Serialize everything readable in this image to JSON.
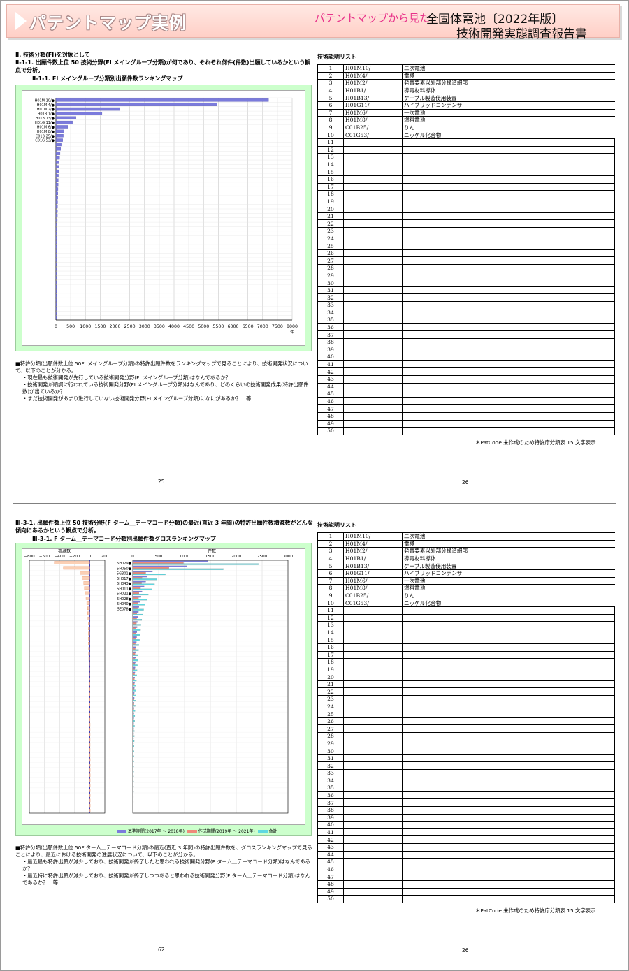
{
  "banner": {
    "title": "パテントマップ実例",
    "subtitle": "パテントマップから見た",
    "doc_title_1": "全固体電池〔2022年版〕",
    "doc_title_2": "技術開発実態調査報告書"
  },
  "page1": {
    "section": "Ⅱ. 技術分類(FI)を対象として",
    "heading": "Ⅱ-1-1. 出願件数上位 50 技術分野(FI メイングループ分類)が何であり、それぞれ何件(件数)出願しているかという観点で分析。",
    "chart_title": "Ⅱ-1-1. FI メイングループ分類別出願件数ランキングマップ",
    "bullets": [
      "■特許分類(出願件数上位 50FI メイングループ分類)の特許出願件数をランキングマップで見ることにより、技術開発状況について、以下のことが分かる。",
      "・現在最も技術開発が先行している技術開発分野(FI メイングループ分類)はなんであるか？",
      "・技術開発が順調に行われている技術開発分野(FI メイングループ分類)はなんであり、どのくらいの技術開発成果(特許出願件数)が出ているか？",
      "・まだ技術開発があまり進行していない技術開発分野(FI メイングループ分類)になにがあるか？　等"
    ],
    "page_left": "25",
    "page_right": "26"
  },
  "page2": {
    "heading": "Ⅲ-3-1. 出願件数上位 50 技術分野(F ターム＿テーマコード分類)の最近(直近 3 年間)の特許出願件数増減数がどんな傾向にあるかという観点で分析。",
    "chart_title": "Ⅲ-3-1. F ターム＿テーマコード分類別出願件数グロスランキングマップ",
    "bullets": [
      "■特許分類(出願件数上位 50F ターム＿テーマコード分類)の最近(直近 3 年間)の特許出願件数を、グロスランキングマップで見ることにより、最近における技術開発の進展状況について、以下のことが分かる。",
      "・最近最も特許出願が減少しており、技術開発が終了したと思われる技術開発分野(F ターム＿テーマコード分類)はなんであるか？",
      "・最近特に特許出願が減少しており、技術開発が終了しつつあると思われる技術開発分野(F ターム＿テーマコード分類)はなんであるか？　等"
    ],
    "page_left": "62",
    "page_right": "26"
  },
  "tech_list": {
    "title": "技術説明リスト",
    "rows": [
      {
        "no": "1",
        "code": "H01M10/",
        "desc": "二次電池"
      },
      {
        "no": "2",
        "code": "H01M4/",
        "desc": "電極"
      },
      {
        "no": "3",
        "code": "H01M2/",
        "desc": "発電要素以外部分構造細部"
      },
      {
        "no": "4",
        "code": "H01B1/",
        "desc": "導電材料導体"
      },
      {
        "no": "5",
        "code": "H01B13/",
        "desc": "ケーブル製造使用装置"
      },
      {
        "no": "6",
        "code": "H01G11/",
        "desc": "ハイブリッドコンデンサ"
      },
      {
        "no": "7",
        "code": "H01M6/",
        "desc": "一次電池"
      },
      {
        "no": "8",
        "code": "H01M8/",
        "desc": "燃料電池"
      },
      {
        "no": "9",
        "code": "C01B25/",
        "desc": "りん"
      },
      {
        "no": "10",
        "code": "C01G53/",
        "desc": "ニッケル化合物"
      }
    ],
    "empty_numbers": [
      "11",
      "12",
      "13",
      "14",
      "15",
      "16",
      "17",
      "18",
      "19",
      "20",
      "21",
      "22",
      "23",
      "24",
      "25",
      "26",
      "27",
      "28",
      "29",
      "30",
      "31",
      "32",
      "33",
      "34",
      "35",
      "36",
      "37",
      "38",
      "39",
      "40",
      "41",
      "42",
      "43",
      "44",
      "45",
      "46",
      "47",
      "48",
      "49",
      "50"
    ],
    "note": "＊PatCode 未作成のため特許庁分類表 15 文字表示"
  },
  "colors": {
    "banner_pink": "#ffcfc6",
    "subtitle_pink": "#e8338a",
    "chart_bg": "#ccffcc",
    "bar_blue": "#7b7bdc",
    "bar_red": "#ef8a7a",
    "bar_cyan": "#5fd8e0"
  },
  "chart_data": [
    {
      "type": "bar",
      "orientation": "horizontal",
      "title": "Ⅱ-1-1. FI メイングループ分類別出願件数ランキングマップ",
      "categories": [
        "H01M 10/●",
        "H01M 4/●",
        "H01M 2/●",
        "H01B 1/●",
        "H01B 13/●",
        "H01G 11/●",
        "H01M 6/●",
        "H01M 8/●",
        "C01B 25/●",
        "C01G 53/●"
      ],
      "values": [
        7200,
        5450,
        2170,
        1560,
        680,
        560,
        400,
        280,
        250,
        230,
        180,
        160,
        140,
        125,
        110,
        100,
        90,
        85,
        80,
        75,
        70,
        66,
        62,
        58,
        55,
        52,
        49,
        46,
        43,
        40,
        38,
        36,
        34,
        32,
        30,
        28,
        26,
        24,
        22,
        20,
        18,
        17,
        16,
        15,
        14,
        13,
        12,
        11,
        10,
        10
      ],
      "xlim": [
        0,
        8000
      ],
      "xticks": [
        "0",
        "500",
        "1000",
        "1500",
        "2000",
        "2500",
        "3000",
        "3500",
        "4000",
        "4500",
        "5000",
        "5500",
        "6000",
        "6500",
        "7000",
        "7500",
        "8000"
      ],
      "xlabel": "件",
      "grid": true
    },
    {
      "type": "bar",
      "orientation": "horizontal",
      "title": "Ⅲ-3-1. F ターム＿テーマコード分類別出願件数グロスランキングマップ",
      "left_axis_label": "増減数",
      "right_axis_label": "件数",
      "categories": [
        "5H029●",
        "5H050●",
        "5G301●",
        "5H017●",
        "5H043●",
        "5H011●",
        "5H021●",
        "5H028●",
        "5H040●",
        "5E078●"
      ],
      "left_xlim": [
        -800,
        200
      ],
      "left_xticks": [
        "−800",
        "−600",
        "−400",
        "−200",
        "0",
        "200"
      ],
      "right_xlim": [
        0,
        3000
      ],
      "right_xticks": [
        "0",
        "500",
        "1000",
        "1500",
        "2000",
        "2500",
        "3000"
      ],
      "series": [
        {
          "name": "基準期間(2017年 ～ 2018年)",
          "values": [
            1450,
            1050,
            380,
            280,
            250,
            220,
            180,
            160,
            140,
            120,
            110,
            100,
            90,
            85,
            80,
            75,
            70,
            65,
            60,
            55,
            50,
            46,
            42,
            38,
            35,
            32,
            30,
            28,
            26,
            24,
            22,
            20,
            18,
            17,
            16,
            15,
            14,
            13,
            12,
            11,
            10,
            10,
            9,
            9,
            8,
            8,
            7,
            7,
            6,
            6
          ]
        },
        {
          "name": "作成期間(2019年 ～ 2021年)",
          "values": [
            980,
            700,
            250,
            180,
            170,
            150,
            120,
            110,
            100,
            90,
            80,
            75,
            70,
            65,
            60,
            55,
            50,
            48,
            45,
            42,
            40,
            37,
            35,
            32,
            30,
            28,
            26,
            24,
            22,
            20,
            18,
            17,
            16,
            15,
            14,
            13,
            12,
            11,
            10,
            10,
            9,
            9,
            8,
            8,
            7,
            7,
            6,
            6,
            5,
            5
          ]
        },
        {
          "name": "合計",
          "values": [
            2430,
            1750,
            630,
            460,
            420,
            370,
            300,
            270,
            240,
            210,
            190,
            175,
            160,
            150,
            140,
            130,
            120,
            113,
            105,
            97,
            90,
            83,
            77,
            70,
            65,
            60,
            56,
            52,
            48,
            44,
            40,
            37,
            34,
            32,
            30,
            28,
            26,
            24,
            22,
            21,
            19,
            19,
            17,
            17,
            15,
            15,
            13,
            13,
            11,
            11
          ]
        },
        {
          "name": "増減数",
          "values": [
            -470,
            -350,
            -130,
            -100,
            -80,
            -70,
            -60,
            -50,
            -40,
            -30,
            -30,
            -25,
            -20,
            -20,
            -20,
            -20,
            -20,
            -17,
            -15,
            -13,
            -10,
            -9,
            -7,
            -6,
            -5,
            -4,
            -4,
            -4,
            -4,
            -4,
            -4,
            -3,
            -2,
            -2,
            -2,
            -2,
            -2,
            -2,
            -2,
            -1,
            -1,
            -1,
            -1,
            -1,
            -1,
            -1,
            -1,
            -1,
            -1,
            -1
          ]
        }
      ],
      "grid": true
    }
  ]
}
